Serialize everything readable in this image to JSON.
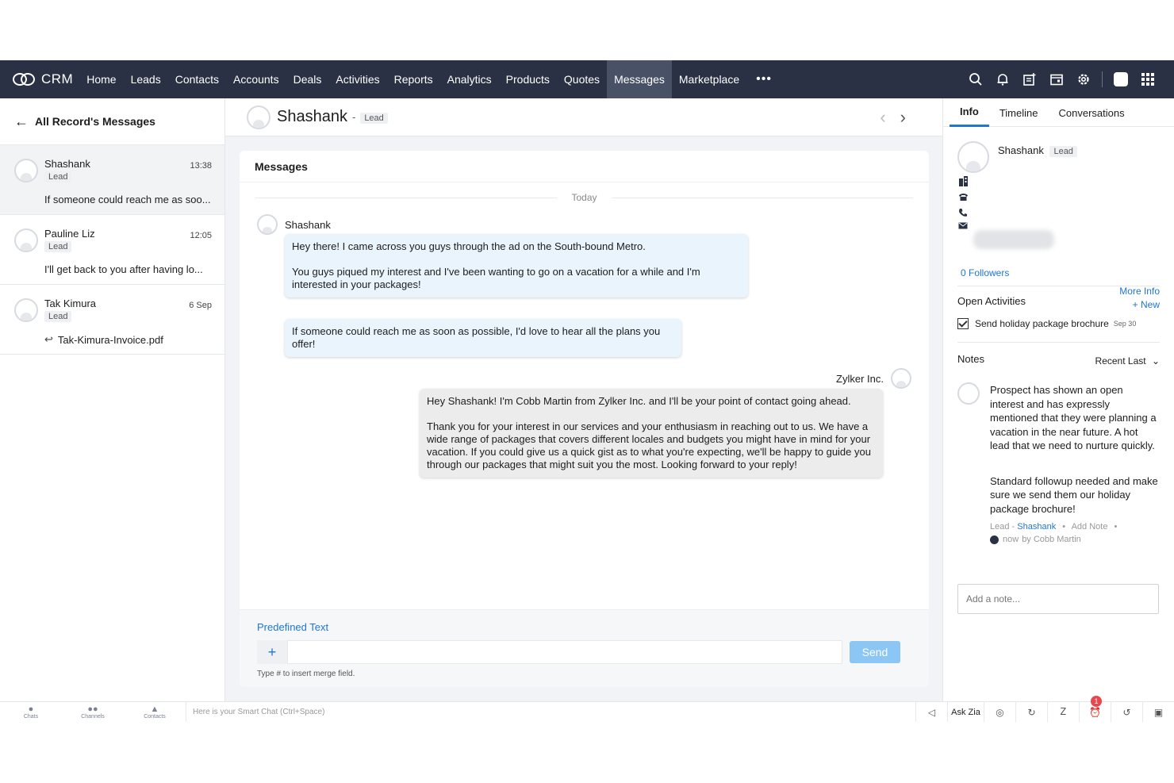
{
  "nav": {
    "brand": "CRM",
    "items": [
      "Home",
      "Leads",
      "Contacts",
      "Accounts",
      "Deals",
      "Activities",
      "Reports",
      "Analytics",
      "Products",
      "Quotes",
      "Messages",
      "Marketplace"
    ],
    "active": "Messages",
    "more": "•••"
  },
  "left": {
    "back_label": "All Record's Messages",
    "conversations": [
      {
        "name": "Shashank",
        "tag": "Lead",
        "time": "13:38",
        "snippet": "If someone could reach me as soo..."
      },
      {
        "name": "Pauline Liz",
        "tag": "Lead",
        "time": "12:05",
        "snippet": "I'll get back to you after having lo..."
      },
      {
        "name": "Tak Kimura",
        "tag": "Lead",
        "time": "6 Sep",
        "attachment": "Tak-Kimura-Invoice.pdf"
      }
    ]
  },
  "header": {
    "name": "Shashank",
    "separator": "-",
    "tag": "Lead"
  },
  "messages": {
    "title": "Messages",
    "day_divider": "Today",
    "incoming_sender": "Shashank",
    "incoming_1_p1": "Hey there! I came across you guys through the ad on the South-bound Metro.",
    "incoming_1_p2": "You guys piqued my interest and I've been wanting to go on a vacation for a while and I'm interested in your packages!",
    "incoming_2": "If someone could reach me as soon as possible, I'd love to hear all the plans you offer!",
    "outgoing_sender": "Zylker Inc.",
    "outgoing_p1": "Hey Shashank! I'm Cobb Martin from Zylker Inc. and I'll be your point of contact going ahead.",
    "outgoing_p2": "Thank you for your interest in our services and your enthusiasm in reaching out to us. We have a wide range of packages that covers different locales and budgets you might have in mind for your vacation. If you could give us a quick gist as to what you're expecting, we'll be happy to guide you through our packages that might suit you the most. Looking forward to your reply!"
  },
  "composer": {
    "predefined": "Predefined Text",
    "plus": "+",
    "input_value": "",
    "send": "Send",
    "hint": "Type # to insert merge field."
  },
  "right": {
    "tabs": [
      "Info",
      "Timeline",
      "Conversations"
    ],
    "active_tab": "Info",
    "name": "Shashank",
    "tag": "Lead",
    "followers": "0 Followers",
    "more_info": "More Info",
    "open_activities": "Open Activities",
    "new_label": "+ New",
    "activity": "Send holiday package brochure",
    "activity_due": "Sep 30",
    "notes_title": "Notes",
    "notes_sort": "Recent Last",
    "note_p1": "Prospect has shown an open interest and has expressly mentioned that they were planning a vacation in the near future. A hot lead that we need to nurture quickly.",
    "note_p2": "Standard followup needed and make sure we send them our holiday package brochure!",
    "note_meta_lead": "Lead",
    "note_meta_sep": "-",
    "note_meta_link": "Shashank",
    "note_meta_add": "Add Note",
    "note_time": "now",
    "note_by": "by Cobb Martin",
    "add_note_placeholder": "Add a note..."
  },
  "bottom": {
    "items": [
      "Chats",
      "Channels",
      "Contacts"
    ],
    "smart_chat": "Here is your Smart Chat (Ctrl+Space)",
    "ask_zia": "Ask Zia",
    "badge": "1"
  },
  "colors": {
    "nav_bg": "#2a3144",
    "accent": "#1f76d3",
    "incoming_bubble": "#eaf4fd",
    "outgoing_bubble": "#ececec",
    "send_button": "#8cc6f5",
    "badge": "#e8474b"
  }
}
